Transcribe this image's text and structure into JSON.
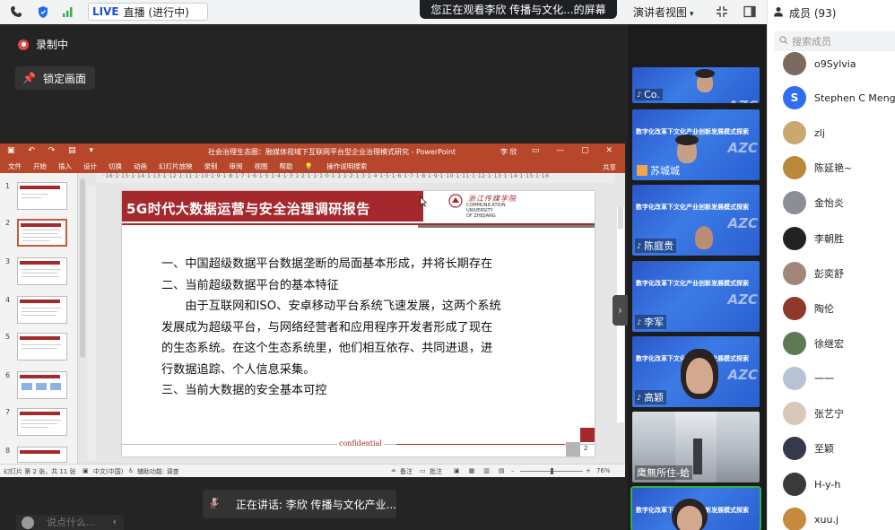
{
  "topbar": {
    "live_label": "LIVE",
    "live_status": "直播 (进行中)",
    "share_banner": "您正在观看李欣 传播与文化...的屏幕",
    "view_mode": "演讲者视图"
  },
  "stage": {
    "recording_label": "录制中",
    "lock_label": "锁定画面"
  },
  "ppt": {
    "window_title": "社会治理生态圈：融媒体视域下互联网平台型企业治理模式研究 - PowerPoint",
    "user": "李 欣",
    "menu": [
      "文件",
      "开始",
      "插入",
      "设计",
      "切换",
      "动画",
      "幻灯片放映",
      "录制",
      "审阅",
      "视图",
      "帮助",
      "操作说明搜索"
    ],
    "share": "共享",
    "ruler": "·16·1·15·1·14·1·13·1·12·1·11·1·10·1·9·1·8·1·7·1·6·1·5·1·4·1·3·1·2·1·1·1·0·1·1·1·2·1·3·1·4·1·5·1·6·1·7·1·8·1·9·1·10·1·11·1·12·1·13·1·14·1·15·1·16",
    "thumb_numbers": [
      "1",
      "2",
      "3",
      "4",
      "5",
      "6",
      "7",
      "8"
    ],
    "slide": {
      "title": "5G时代大数据运营与安全治理调研报告",
      "logo_cn": "浙江传媒学院",
      "logo_en_1": "COMMUNICATION",
      "logo_en_2": "UNIVERSITY",
      "logo_en_3": "OF ZHEJIANG",
      "lines": [
        "一、中国超级数据平台数据垄断的局面基本形成，并将长期存在",
        "二、当前超级数据平台的基本特征",
        "　　由于互联网和ISO、安卓移动平台系统飞速发展，这两个系统",
        "发展成为超级平台，与网络经营者和应用程序开发者形成了现在",
        "的生态系统。在这个生态系统里，他们相互依存、共同进退，进",
        "行数据追踪、个人信息采集。",
        "三、当前大数据的安全基本可控"
      ],
      "footer": "confidential",
      "page_number": "2"
    },
    "status": {
      "slide_info": "幻灯片 第 2 张，共 11 张",
      "language": "中文(中国)",
      "accessibility": "辅助功能: 调查",
      "notes": "备注",
      "comments": "批注",
      "zoom": "76%"
    }
  },
  "talk_bar": "正在讲话: 李欣 传播与文化产业...",
  "chat_placeholder": "说点什么...",
  "videos": [
    {
      "name": "Co.",
      "banner": ""
    },
    {
      "name": "苏城城",
      "banner": "数字化改革下文化产业创新发展模式探索"
    },
    {
      "name": "陈庭贵",
      "banner": "数字化改革下文化产业创新发展模式探索"
    },
    {
      "name": "李军",
      "banner": "数字化改革下文化产业创新发展模式探索"
    },
    {
      "name": "高颖",
      "banner": "数字化改革下文化产业创新发展模式探索"
    },
    {
      "name": "鹰無所住-蛤",
      "banner": ""
    },
    {
      "name": "",
      "banner": "数字化改革下文化产业创新发展模式探索"
    }
  ],
  "members": {
    "title": "成员 (93)",
    "search_placeholder": "搜索成员",
    "list": [
      {
        "name": "o9Sylvia",
        "initial": "",
        "color": "#7a6a60"
      },
      {
        "name": "Stephen C Meng",
        "initial": "S",
        "color": "#2f6ef0"
      },
      {
        "name": "zlj",
        "initial": "",
        "color": "#c9a96e"
      },
      {
        "name": "陈延艳~",
        "initial": "",
        "color": "#b88a3a"
      },
      {
        "name": "金怡炎",
        "initial": "",
        "color": "#8a8f96"
      },
      {
        "name": "李朝胜",
        "initial": "",
        "color": "#222222"
      },
      {
        "name": "彭奕舒",
        "initial": "",
        "color": "#a08878"
      },
      {
        "name": "陶伦",
        "initial": "",
        "color": "#8d3a2a"
      },
      {
        "name": "徐继宏",
        "initial": "",
        "color": "#5d7a55"
      },
      {
        "name": "一一",
        "initial": "",
        "color": "#b6c3d4"
      },
      {
        "name": "张艺宁",
        "initial": "",
        "color": "#d8c8b8"
      },
      {
        "name": "至颖",
        "initial": "",
        "color": "#35394a"
      },
      {
        "name": "H-y-h",
        "initial": "",
        "color": "#3a3a3a"
      },
      {
        "name": "xuu.j",
        "initial": "",
        "color": "#c58a3d"
      }
    ]
  }
}
